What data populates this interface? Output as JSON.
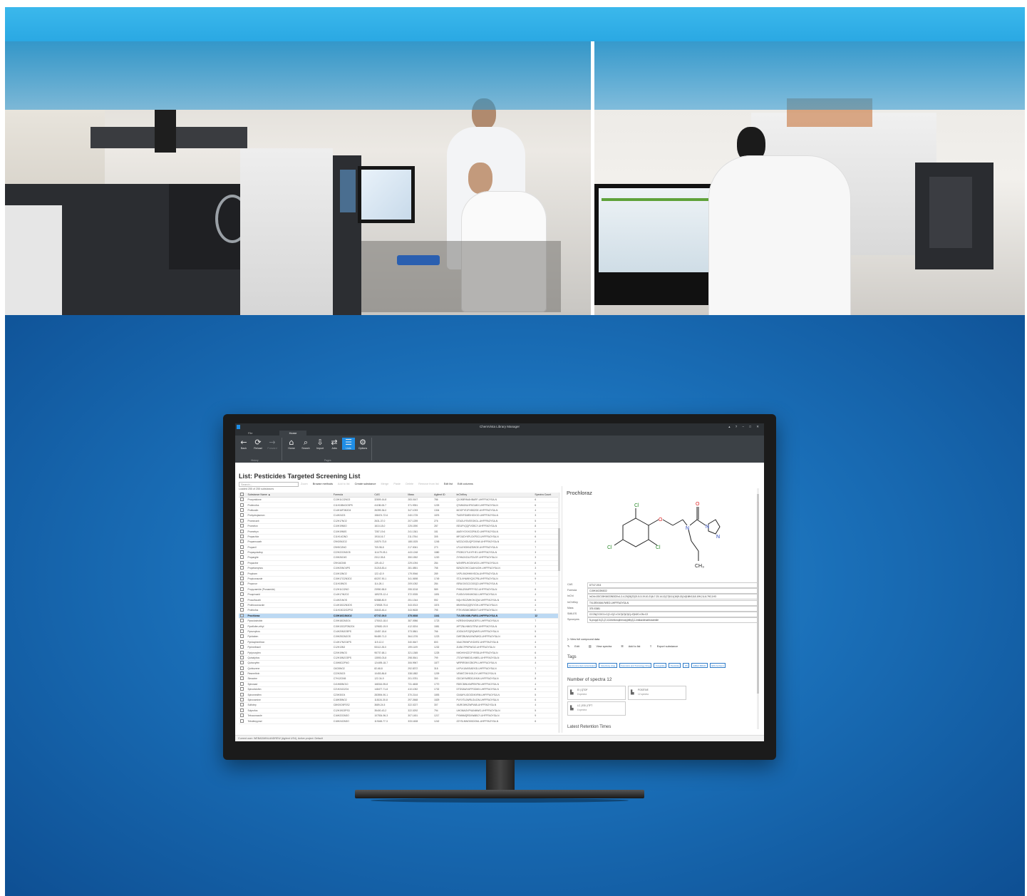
{
  "app": {
    "title": "ChemVista Library Manager",
    "window_controls": "▴  ?  –  □  ✕",
    "tabs": [
      "File",
      "Home"
    ]
  },
  "ribbon": {
    "history": {
      "label": "History",
      "buttons": [
        {
          "label": "Back",
          "icon": "←"
        },
        {
          "label": "Reload",
          "icon": "⟳"
        },
        {
          "label": "Forward",
          "icon": "→"
        }
      ]
    },
    "pages": {
      "label": "Pages",
      "buttons": [
        {
          "label": "Home",
          "icon": "⌂"
        },
        {
          "label": "Search",
          "icon": "⌕"
        },
        {
          "label": "Import",
          "icon": "⇩"
        },
        {
          "label": "Jobs",
          "icon": "⇄"
        },
        {
          "label": "Lists",
          "icon": "☰"
        },
        {
          "label": "Options",
          "icon": "⚙"
        }
      ]
    }
  },
  "list": {
    "title": "List: Pesticides Targeted Screening List",
    "search_placeholder": "Search...",
    "loaded": "Loaded 255 of 255 substances",
    "toolbar": [
      {
        "label": "Zoom",
        "enabled": false
      },
      {
        "label": "Browse methods",
        "enabled": true
      },
      {
        "label": "Add to list",
        "enabled": false
      },
      {
        "label": "Create substance",
        "enabled": true
      },
      {
        "label": "Merge",
        "enabled": false
      },
      {
        "label": "Paste",
        "enabled": false
      },
      {
        "label": "Delete",
        "enabled": false
      },
      {
        "label": "Remove from list",
        "enabled": false
      },
      {
        "label": "Edit list",
        "enabled": true
      },
      {
        "label": "Edit columns",
        "enabled": true
      }
    ],
    "columns": [
      "",
      "Substance Name ▲",
      "Formula",
      "CAS",
      "Mass",
      "Agilent ID",
      "InChIKey",
      "Spectra Count"
    ],
    "rows": [
      [
        "Procymidone",
        "C13H11Cl2NO2",
        "32809-16-8",
        "283.0167",
        "786",
        "QXJKBPAVAHBARF-UHFFFAOYSA-N",
        "6"
      ],
      [
        "Profenofos",
        "C11H15BrClO3PS",
        "41198-08-7",
        "371.9351",
        "1225",
        "QYMMJNLHFKGANY-UHFFFAOYSA-N",
        "6"
      ],
      [
        "Profluralin",
        "C14H16F3N3O4",
        "26399-36-0",
        "347.1093",
        "1304",
        "MOOFYEJFXBSZGE-UHFFFAOYSA-N",
        "4"
      ],
      [
        "Prohydrojasmon",
        "C14H24O3",
        "158474-72-6",
        "240.1725",
        "1876",
        "TWZKFGMEIHOXOO-UHFFFAOYSA-N",
        "3"
      ],
      [
        "Promecarb",
        "C12H17NO2",
        "2631-37-0",
        "207.1259",
        "276",
        "DTAOUYSVEEOKDL-UHFFFAOYSA-N",
        "5"
      ],
      [
        "Prometon",
        "C10H19N5O",
        "1610-18-0",
        "225.1590",
        "287",
        "ISEUFVQQFVOBCY-UHFFFAOYSA-N",
        "8"
      ],
      [
        "Prometryn",
        "C10H19N5S",
        "7287-19-6",
        "241.1361",
        "181",
        "AAEVYOVXGOFMJO-UHFFFAOYSA-N",
        "9"
      ],
      [
        "Propachlor",
        "C11H14ClNO",
        "1918-16-7",
        "211.0764",
        "305",
        "MFOUDYKPLGXPGO-UHFFFAOYSA-N",
        "6"
      ],
      [
        "Propamocarb",
        "C9H20N2O2",
        "24579-73-5",
        "188.1525",
        "1245",
        "WZZLDXDUQPOXNW-UHFFFAOYSA-N",
        "4"
      ],
      [
        "Propanil",
        "C9H9Cl2NO",
        "709-98-8",
        "217.0061",
        "273",
        "LFULEKSKNZEWOE-UHFFFAOYSA-N",
        "7"
      ],
      [
        "Propaquizafop",
        "C22H22ClN3O5",
        "111479-05-1",
        "443.1248",
        "1880",
        "FROBCXTULYFHEJ-UHFFFAOYSA-N",
        "3"
      ],
      [
        "Propargite",
        "C19H26O4S",
        "2312-35-8",
        "350.1552",
        "1220",
        "ZYHMJXZULPZUOF-UHFFFAOYSA-N",
        "3"
      ],
      [
        "Propazine",
        "C9H16ClN5",
        "139-40-2",
        "229.1094",
        "284",
        "WJNRPILHGGKWCK-UHFFFAOYSA-N",
        "8"
      ],
      [
        "Propetamphos",
        "C10H20NO4PS",
        "31218-83-4",
        "281.0851",
        "758",
        "BZNZXOHCCAAHLIDH-UHFFFAOYSA-N",
        "3"
      ],
      [
        "Propham",
        "C10H13NO2",
        "122-42-9",
        "179.0946",
        "289",
        "VXPLXMJHHKHSOA-UHFFFAOYSA-N",
        "5"
      ],
      [
        "Propiconazole",
        "C15H17Cl2N3O2",
        "60207-90-1",
        "341.0698",
        "1749",
        "STJLVHWMYQXCPB-UHFFFAOYSA-N",
        "9"
      ],
      [
        "Propoxur",
        "C11H15NO3",
        "114-26-1",
        "209.1052",
        "284",
        "ISRUGXGCCGIOQO-UHFFFAOYSA-N",
        "7"
      ],
      [
        "Propyzamide (Pronamide)",
        "C12H11Cl2NO",
        "23950-58-5",
        "255.0218",
        "589",
        "PHNUZKMIPFFYSO-UHFFFAOYSA-N",
        "6"
      ],
      [
        "Proquinazid",
        "C14H17IN2O2",
        "189278-12-4",
        "372.0335",
        "1891",
        "FLVBXVXHNIHGNX-UHFFFAOYSA-N",
        "4"
      ],
      [
        "Prosulfocarb",
        "C14H21NOS",
        "52888-80-9",
        "251.1344",
        "592",
        "NQLHSCZMHOHJQW-UHFFFAOYSA-N",
        "6"
      ],
      [
        "Prothioconazole",
        "C14H15Cl2N3OS",
        "178928-70-6",
        "343.0313",
        "1874",
        "MNHVNIJQQRJYDH-UHFFFAOYSA-N",
        "4"
      ],
      [
        "Prothiofos",
        "C11H15Cl2O2PS2",
        "34643-46-4",
        "343.9628",
        "795",
        "FITKVSGMCMBDVT-UHFFFAOYSA-N",
        "6"
      ],
      [
        "Prochloraz",
        "C15H16Cl3N3O2",
        "67747-09-5",
        "375.0308",
        "1341",
        "TVLSRXXIMLFWEO-UHFFFAOYSA-N",
        "12"
      ],
      [
        "Pyraclostrobin",
        "C19H18ClN3O4",
        "175013-18-0",
        "387.0986",
        "1723",
        "HZRSNVGNWUDEFX-UHFFFAOYSA-N",
        "7"
      ],
      [
        "Pyraflufen-ethyl",
        "C15H13Cl2F3N2O4",
        "129630-19-9",
        "412.0204",
        "1881",
        "APTZNLHMIGJTEW-UHFFFAOYSA-N",
        "3"
      ],
      [
        "Pyrazophos",
        "C14H20N3O5PS",
        "13457-18-6",
        "373.0861",
        "766",
        "JOOMJVFZQRQWKR-UHFFFAOYSA-N",
        "5"
      ],
      [
        "Pyridaben",
        "C19H25ClN2OS",
        "96489-71-3",
        "364.1376",
        "1223",
        "DWFZBUWUXWZWKD-UHFFFAOYSA-N",
        "6"
      ],
      [
        "Pyridaphenthion",
        "C14H17N2O4PS",
        "119-12-0",
        "340.0647",
        "803",
        "XAUCRKWFVKDXRZ-UHFFFAOYSA-N",
        "4"
      ],
      [
        "Pyrimethanil",
        "C12H13N3",
        "53112-28-0",
        "199.1109",
        "1232",
        "ZLIBICFPKPWGIZ-UHFFFAOYSA-N",
        "9"
      ],
      [
        "Pyriproxyfen",
        "C20H19NO3",
        "95737-68-1",
        "321.1365",
        "1225",
        "NHDHVHZZCFYRSB-UHFFFAOYSA-N",
        "6"
      ],
      [
        "Quinalphos",
        "C12H15N2O3PS",
        "13593-03-8",
        "298.0541",
        "799",
        "JTCWYMMDGLHMEU-UHFFFAOYSA-N",
        "5"
      ],
      [
        "Quinoxyfen",
        "C15H8Cl2FNO",
        "124495-18-7",
        "306.9967",
        "1877",
        "WRPIRSINYZBGPK-UHFFFAOYSA-N",
        "4"
      ],
      [
        "Quintozene",
        "C6Cl5NO2",
        "82-68-8",
        "292.8372",
        "318",
        "LKPLKUMXSAEKID-UHFFFAOYSA-N",
        "7"
      ],
      [
        "Resmethrin",
        "C22H26O3",
        "10453-86-8",
        "338.1882",
        "1209",
        "VEMKTZHHVJILDY-UHFFFAOYSA-N",
        "3"
      ],
      [
        "Simazine",
        "C7H12ClN5",
        "122-34-9",
        "201.0781",
        "300",
        "ODCWYMIRDDJXKW-UHFFFAOYSA-N",
        "8"
      ],
      [
        "Spinosad",
        "C41H65NO10",
        "168316-95-8",
        "731.4608",
        "1770",
        "RDECBWLKMPEKPM-UHFFFAOYSA-N",
        "4"
      ],
      [
        "Spirodiclofen",
        "C21H24Cl2O4",
        "148477-71-8",
        "410.1052",
        "1702",
        "DTDSAWVUFPGDMX-UHFFFAOYSA-N",
        "6"
      ],
      [
        "Spiromesifen",
        "C23H30O4",
        "283594-90-1",
        "370.2144",
        "1893",
        "GXAMYUGOODKVRM-UHFFFAOYSA-N",
        "5"
      ],
      [
        "Spiroxamine",
        "C18H35NO2",
        "118134-30-8",
        "297.2668",
        "1829",
        "PUYXTUJWRLOUCW-UHFFFAOYSA-N",
        "6"
      ],
      [
        "Sulfotep",
        "C8H20O5P2S2",
        "3689-24-5",
        "322.0227",
        "307",
        "XIUROWKZWPIAIB-UHFFFAOYSA-N",
        "4"
      ],
      [
        "Sulprofos",
        "C12H19O2PS3",
        "35400-43-2",
        "322.0292",
        "794",
        "UHOMAGVFNUNMWO-UHFFFAOYSA-N",
        "5"
      ],
      [
        "Tebuconazole",
        "C16H22ClN3O",
        "107534-96-3",
        "307.1451",
        "1217",
        "PXMNMQRDXWABCY-UHFFFAOYSA-N",
        "9"
      ],
      [
        "Tebufenpyrad",
        "C18H24ClN3O",
        "119168-77-3",
        "333.1608",
        "1242",
        "ZZYSLNWGKKDOML-UHFFFAOYSA-N",
        "6"
      ]
    ],
    "selected_row": "Prochloraz"
  },
  "detail": {
    "title": "Prochloraz",
    "props": [
      {
        "k": "CAS",
        "v": "67747-09-5"
      },
      {
        "k": "Formula",
        "v": "C15H16Cl3N3O2"
      },
      {
        "k": "InChI",
        "v": "InChI=1S/C15H16Cl3N3O2/c1-2-4-20(15(22)21-5-3-19-10-21)6-7-23-14-12(17)8-11(16)9-13(14)18/h3,5,8-10H,2,4,6-7H2,1H3"
      },
      {
        "k": "InChIKey",
        "v": "TVLSRXXIMLFWEO-UHFFFAOYSA-N"
      },
      {
        "k": "Mass",
        "v": "375.03081"
      },
      {
        "k": "SMILES",
        "v": "CCCN(CCOC1=C(C=C(C=C1Cl)Cl)Cl)C(=O)N2C=CN=C2"
      },
      {
        "k": "Synonyms",
        "v": "N-propyl-N-[2-(2,4,6-trichlorophenoxy)ethyl]-1-imidazolecarboxamide"
      }
    ],
    "view_full": "View full compound data",
    "actions": [
      "Edit",
      "View spectra",
      "Add to list",
      "Export substance"
    ],
    "tags_heading": "Tags",
    "tags": [
      "Environmental contaminant",
      "Veterinary drug",
      "Forensics and Toxicology Drug",
      "Fungicide",
      "Pesticide",
      "PS",
      "EMEA BRUR",
      "EPA Ambient"
    ],
    "spectra_heading": "Number of spectra 12",
    "spectra": [
      {
        "title": "EI | QTOF",
        "count": "8 spectra"
      },
      {
        "title": "POSITIVE",
        "count": "12 spectra"
      },
      {
        "title": "LC | ESI | ITFT",
        "count": "6 spectra"
      }
    ],
    "retention_heading": "Latest Retention Times",
    "molecule_labels": {
      "cl1": "Cl",
      "cl2": "Cl",
      "cl3": "Cl",
      "o1": "O",
      "o2": "O",
      "n1": "N",
      "n2": "N",
      "n3": "N",
      "ch3": "CH₃"
    }
  },
  "status": "Current user: WEBADMINLANDREW (Agilent US4), Active project: Default"
}
